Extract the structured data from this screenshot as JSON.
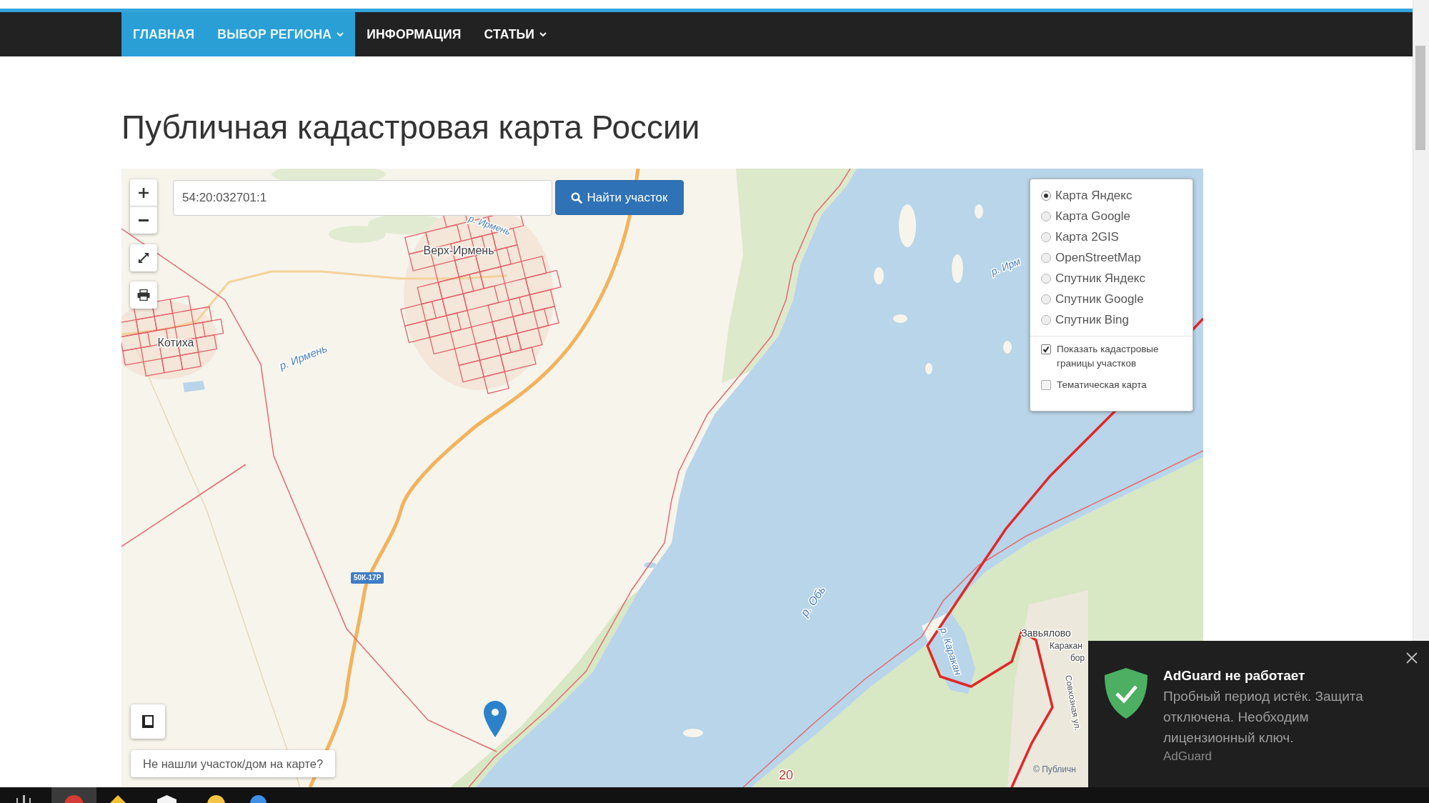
{
  "nav": {
    "items": [
      {
        "label": "ГЛАВНАЯ",
        "highlighted": true,
        "dropdown": false
      },
      {
        "label": "ВЫБОР РЕГИОНА",
        "highlighted": true,
        "dropdown": true
      },
      {
        "label": "ИНФОРМАЦИЯ",
        "highlighted": false,
        "dropdown": false
      },
      {
        "label": "СТАТЬИ",
        "highlighted": false,
        "dropdown": true
      }
    ]
  },
  "page_title": "Публичная кадастровая карта России",
  "map": {
    "search": {
      "value": "54:20:032701:1",
      "button": "Найти участок"
    },
    "layers": {
      "options": [
        {
          "label": "Карта Яндекс",
          "selected": true
        },
        {
          "label": "Карта Google",
          "selected": false
        },
        {
          "label": "Карта 2GIS",
          "selected": false
        },
        {
          "label": "OpenStreetMap",
          "selected": false
        },
        {
          "label": "Спутник Яндекс",
          "selected": false
        },
        {
          "label": "Спутник Google",
          "selected": false
        },
        {
          "label": "Спутник Bing",
          "selected": false
        }
      ],
      "toggles": [
        {
          "label": "Показать кадастровые границы участков",
          "checked": true
        },
        {
          "label": "Тематическая карта",
          "checked": false
        }
      ]
    },
    "labels": [
      {
        "text": "р. Ирмень",
        "kind": "water"
      },
      {
        "text": "Верх-Ирмень",
        "kind": "place"
      },
      {
        "text": "р. Ирм",
        "kind": "water"
      },
      {
        "text": "Котиха",
        "kind": "place"
      },
      {
        "text": "р. Ирмень",
        "kind": "water"
      },
      {
        "text": "р. Обь",
        "kind": "water"
      },
      {
        "text": "Завьялово",
        "kind": "place"
      },
      {
        "text": "р. Каракан",
        "kind": "water"
      },
      {
        "text": "Каракан",
        "kind": "place"
      },
      {
        "text": "бор",
        "kind": "place"
      },
      {
        "text": "Совхозная ул.",
        "kind": "street"
      },
      {
        "text": "20",
        "kind": "road_number"
      }
    ],
    "road_sign": "50К-17Р",
    "attribution": "© Публичн",
    "report_button": "Не нашли участок/дом на карте?"
  },
  "notification": {
    "title": "AdGuard не работает",
    "message": "Пробный период истёк. Защита отключена. Необходим лицензионный ключ.",
    "source": "AdGuard"
  }
}
